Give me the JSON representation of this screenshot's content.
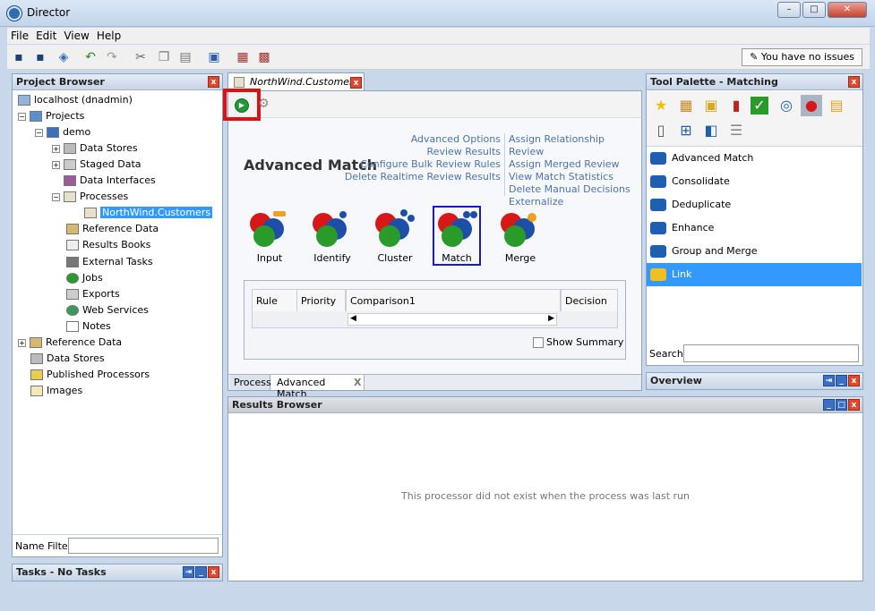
{
  "window": {
    "title": "Director",
    "min": "–",
    "max": "□",
    "close": "✕"
  },
  "menu": [
    "File",
    "Edit",
    "View",
    "Help"
  ],
  "status": {
    "issues": "You have no issues"
  },
  "project_browser": {
    "title": "Project Browser",
    "filter_label": "Name Filter",
    "filter_value": "",
    "items": [
      {
        "label": "localhost (dnadmin)"
      },
      {
        "label": "Projects"
      },
      {
        "label": "demo"
      },
      {
        "label": "Data Stores"
      },
      {
        "label": "Staged Data"
      },
      {
        "label": "Data Interfaces"
      },
      {
        "label": "Processes"
      },
      {
        "label": "NorthWind.Customers"
      },
      {
        "label": "Reference Data"
      },
      {
        "label": "Results Books"
      },
      {
        "label": "External Tasks"
      },
      {
        "label": "Jobs"
      },
      {
        "label": "Exports"
      },
      {
        "label": "Web Services"
      },
      {
        "label": "Notes"
      },
      {
        "label": "Reference Data"
      },
      {
        "label": "Data Stores"
      },
      {
        "label": "Published Processors"
      },
      {
        "label": "Images"
      }
    ]
  },
  "tasks": {
    "title": "Tasks - No Tasks"
  },
  "editor": {
    "tab": "NorthWind.Customers",
    "heading": "Advanced Match",
    "links_left": [
      "Advanced Options",
      "Review Results",
      "Configure Bulk Review Rules",
      "Delete Realtime Review Results"
    ],
    "links_right": [
      "Assign Relationship Review",
      "Assign Merged Review",
      "View Match Statistics",
      "Delete Manual Decisions",
      "Externalize"
    ],
    "processors": [
      "Input",
      "Identify",
      "Cluster",
      "Match",
      "Merge"
    ],
    "table_headers": [
      "Rule",
      "Priority",
      "Comparison1",
      "Decision"
    ],
    "show_summary": "Show Summary",
    "bottom_tabs": [
      "Process",
      "Advanced Match"
    ],
    "close_tab": "X"
  },
  "palette": {
    "title": "Tool Palette - Matching",
    "items": [
      "Advanced Match",
      "Consolidate",
      "Deduplicate",
      "Enhance",
      "Group and Merge",
      "Link"
    ],
    "selected": "Link",
    "search_label": "Search",
    "search_value": ""
  },
  "overview": {
    "title": "Overview"
  },
  "results": {
    "title": "Results Browser",
    "message": "This processor did not exist when the process was last run"
  },
  "colors": {
    "highlight": "#3399ff",
    "red_box": "#e01010",
    "link": "#4f73a8"
  }
}
